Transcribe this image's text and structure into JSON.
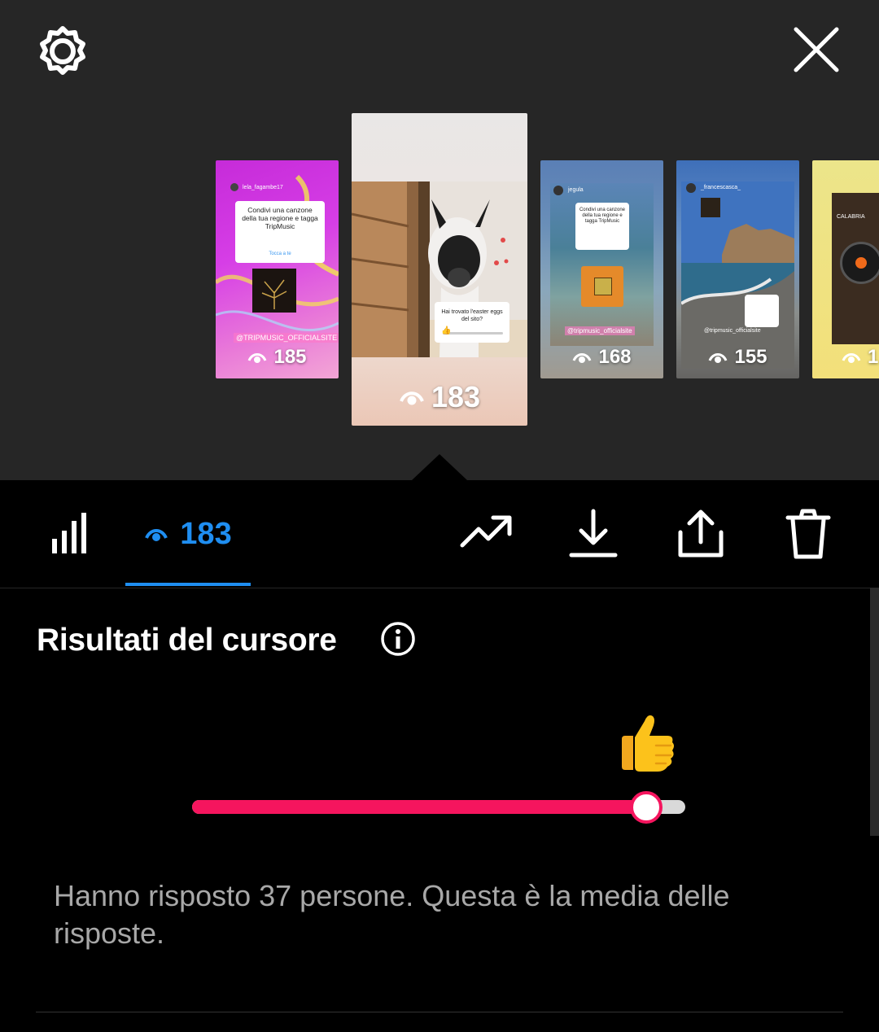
{
  "header": {
    "settings_icon": "gear-icon",
    "close_icon": "close-icon"
  },
  "stories": [
    {
      "views": "185",
      "username": "lela_fagambe17",
      "sticker_text": "Condivi una canzone della tua regione e tagga TripMusic",
      "reply_label": "Tocca a te",
      "tag": "@TRIPMUSIC_OFFICIALSITE"
    },
    {
      "views": "183",
      "question": "Hai trovato l'easter eggs del sito?"
    },
    {
      "views": "168",
      "username": "jegula",
      "sticker_text": "Condivi una canzone della tua regione e tagga TripMusic",
      "tag": "@tripmusic_officialsite"
    },
    {
      "views": "155",
      "username": "_francescasca_",
      "tag": "@tripmusic_officialsite"
    },
    {
      "views": "1",
      "label": "CALABRIA"
    }
  ],
  "tabbar": {
    "views_count": "183"
  },
  "slider_results": {
    "title": "Risultati del cursore",
    "average": 0.92,
    "emoji": "thumbs-up",
    "description": "Hanno risposto 37 persone. Questa è la media delle risposte."
  },
  "colors": {
    "accent_blue": "#1f8ef1",
    "slider_pink": "#f5155e",
    "background": "#000000",
    "top_background": "#262626"
  }
}
